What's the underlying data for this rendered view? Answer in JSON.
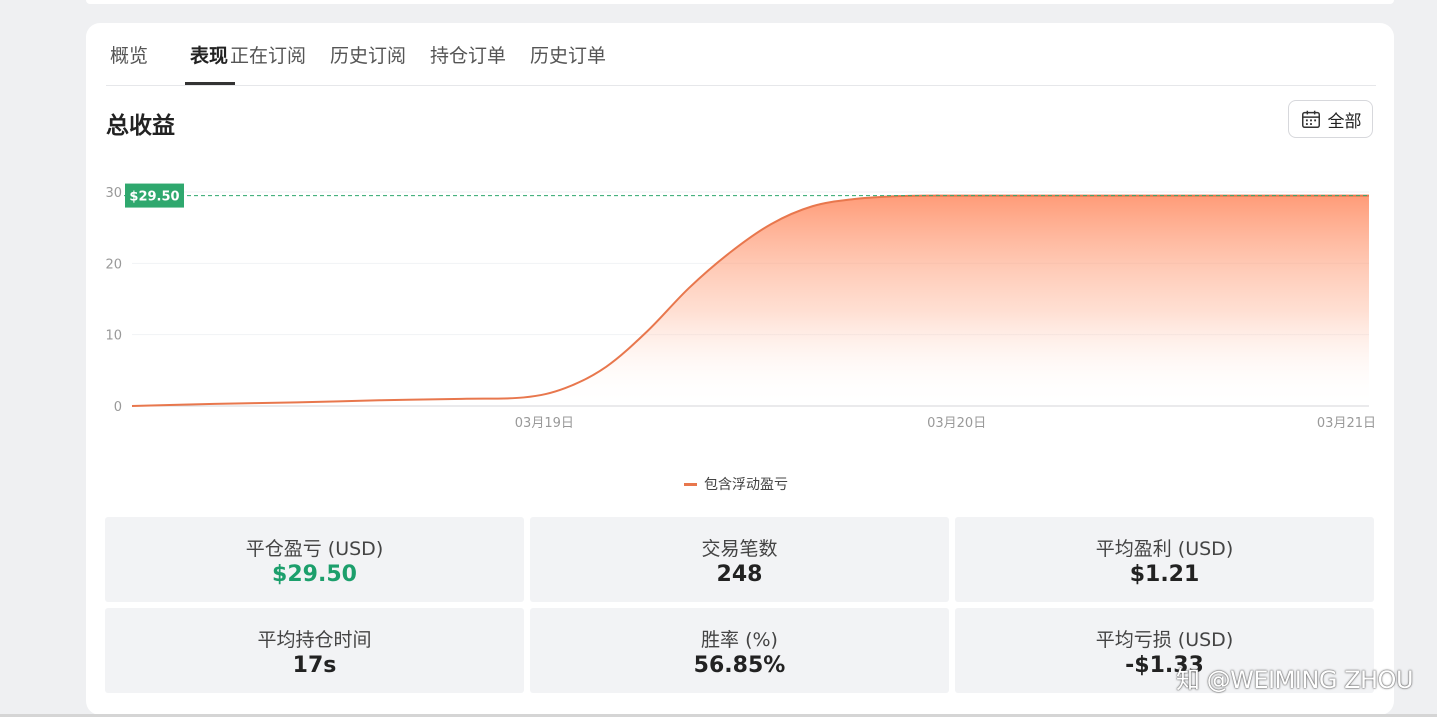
{
  "tabs": [
    "概览",
    "表现",
    "正在订阅",
    "历史订阅",
    "持仓订单",
    "历史订单"
  ],
  "active_tab": 1,
  "section_title": "总收益",
  "range_button": {
    "label": "全部",
    "icon": "calendar-icon"
  },
  "chart_data": {
    "type": "area",
    "title": "总收益",
    "series": [
      {
        "name": "包含浮动盈亏",
        "color": "#e8774d",
        "x": [
          0.0,
          0.2,
          0.4,
          0.6,
          0.8,
          0.95,
          1.05,
          1.15,
          1.25,
          1.35,
          1.45,
          1.55,
          1.65,
          1.75,
          1.85,
          1.95,
          2.0,
          2.5,
          3.0
        ],
        "y": [
          0.0,
          0.3,
          0.5,
          0.8,
          1.0,
          1.2,
          2.5,
          5.5,
          10.5,
          16.5,
          21.5,
          25.5,
          28.0,
          29.0,
          29.4,
          29.5,
          29.5,
          29.5,
          29.5
        ]
      }
    ],
    "x_ticks": [
      {
        "value": 1,
        "label": "03月19日"
      },
      {
        "value": 2,
        "label": "03月20日"
      },
      {
        "value": 3,
        "label": "03月21日"
      }
    ],
    "y_ticks": [
      0,
      10,
      20,
      30
    ],
    "ylim": [
      0,
      30
    ],
    "xlim": [
      0,
      3
    ],
    "reference_line": {
      "value": 29.5,
      "label": "$29.50",
      "color": "#2fa86e"
    },
    "legend": "bottom-center"
  },
  "stats": [
    {
      "label": "平仓盈亏 (USD)",
      "value": "$29.50",
      "positive": true
    },
    {
      "label": "交易笔数",
      "value": "248"
    },
    {
      "label": "平均盈利 (USD)",
      "value": "$1.21"
    },
    {
      "label": "平均持仓时间",
      "value": "17s"
    },
    {
      "label": "胜率 (%)",
      "value": "56.85%"
    },
    {
      "label": "平均亏损 (USD)",
      "value": "-$1.33"
    }
  ],
  "watermark": "知 @WEIMING ZHOU"
}
